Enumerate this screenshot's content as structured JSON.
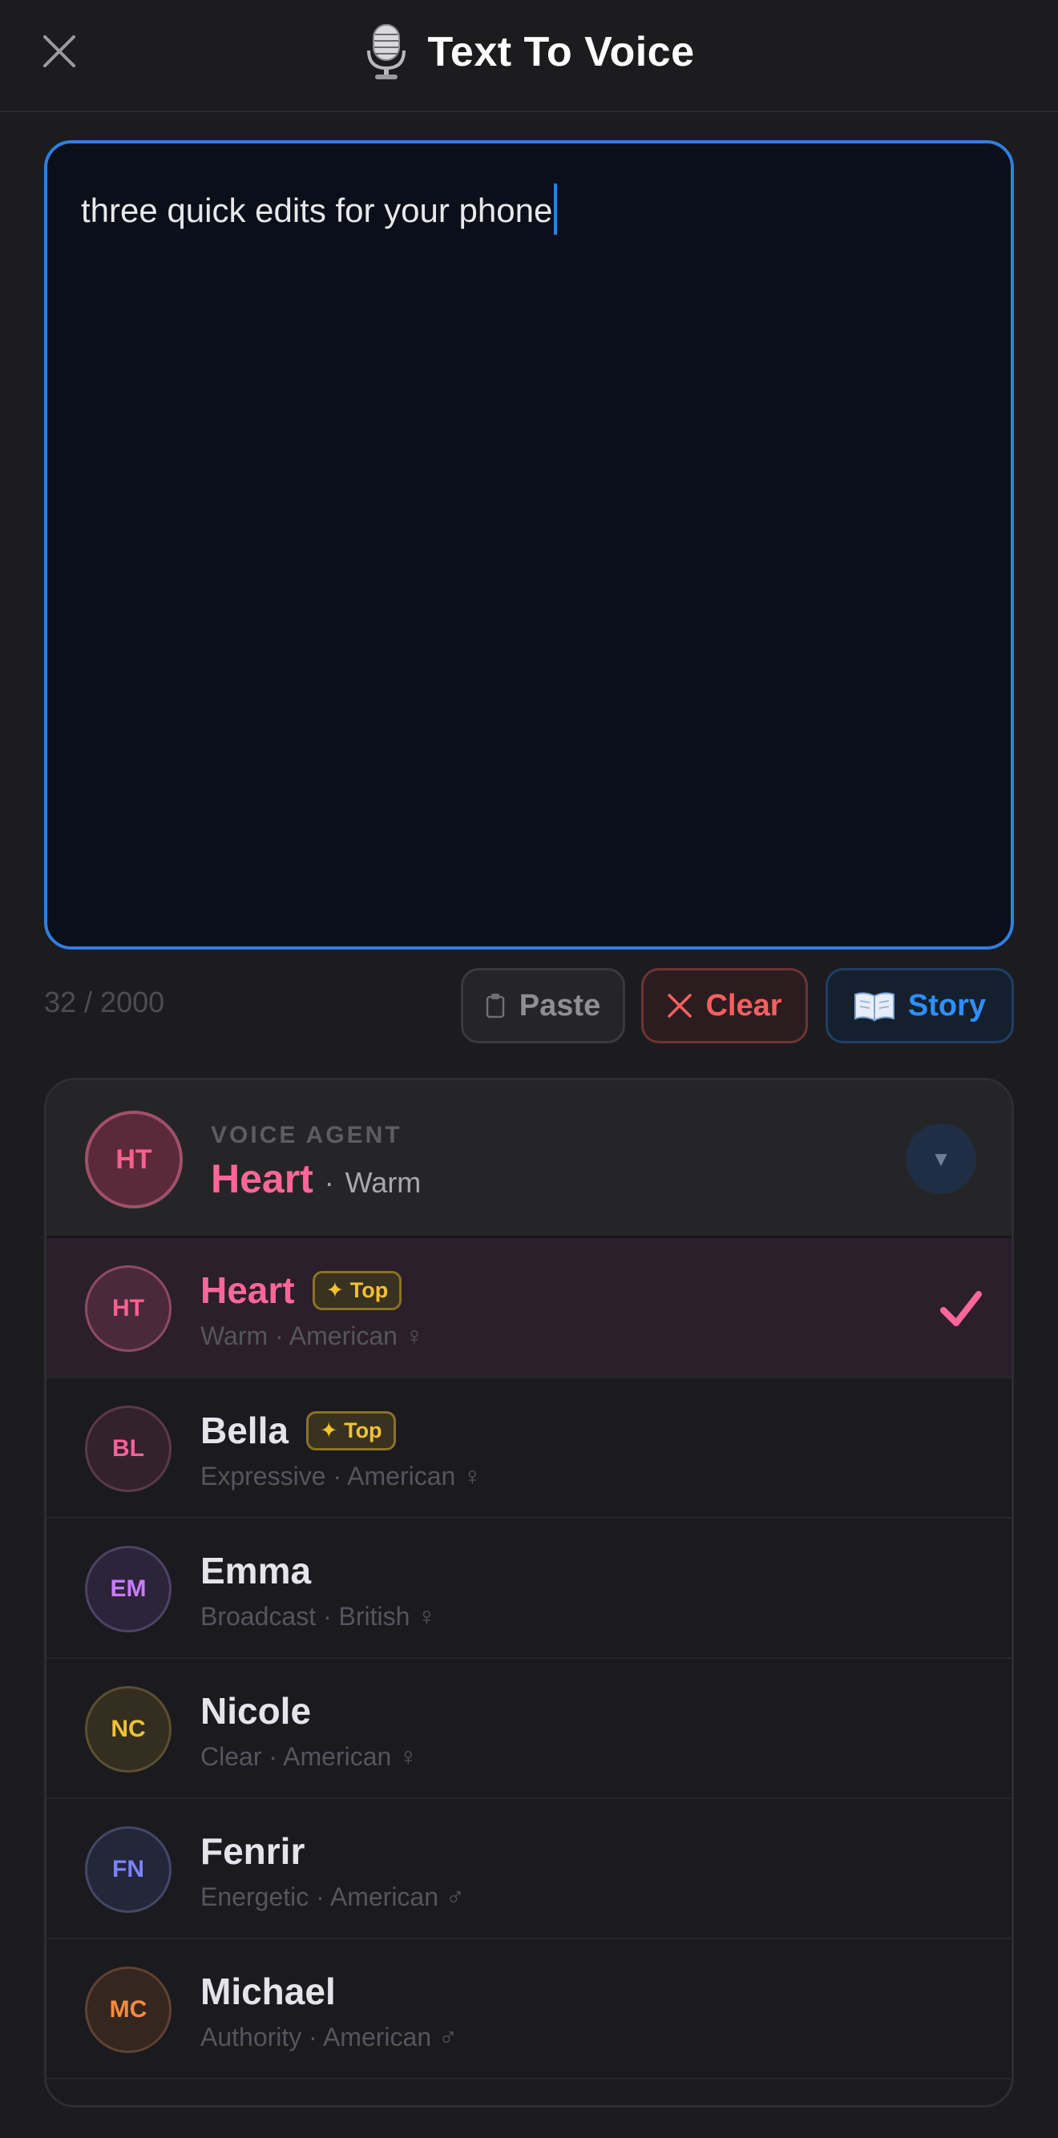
{
  "header": {
    "title": "Text To Voice",
    "close_icon": "close-icon",
    "title_icon": "microphone-icon"
  },
  "editor": {
    "text": "three quick edits for your phone",
    "counter": "32 / 2000"
  },
  "actions": {
    "paste_label": "Paste",
    "paste_icon": "clipboard-icon",
    "clear_label": "Clear",
    "clear_icon": "x-icon",
    "story_label": "Story",
    "story_icon": "book-icon"
  },
  "agent": {
    "label": "VOICE AGENT",
    "initials": "HT",
    "name": "Heart",
    "separator": "·",
    "trait": "Warm",
    "dropdown_icon": "chevron-down-icon"
  },
  "voices": [
    {
      "initials": "HT",
      "name": "Heart",
      "badge": "✦ Top",
      "desc": "Warm · American ♀",
      "selected": true
    },
    {
      "initials": "BL",
      "name": "Bella",
      "badge": "✦ Top",
      "desc": "Expressive · American ♀",
      "selected": false
    },
    {
      "initials": "EM",
      "name": "Emma",
      "badge": "",
      "desc": "Broadcast · British ♀",
      "selected": false
    },
    {
      "initials": "NC",
      "name": "Nicole",
      "badge": "",
      "desc": "Clear · American ♀",
      "selected": false
    },
    {
      "initials": "FN",
      "name": "Fenrir",
      "badge": "",
      "desc": "Energetic · American ♂",
      "selected": false
    },
    {
      "initials": "MC",
      "name": "Michael",
      "badge": "",
      "desc": "Authority · American ♂",
      "selected": false
    }
  ],
  "colors": {
    "accent_blue": "#2f7fe0",
    "accent_pink": "#ff6699",
    "clear_red": "#ff5e5e",
    "badge_gold": "#f1c232"
  }
}
